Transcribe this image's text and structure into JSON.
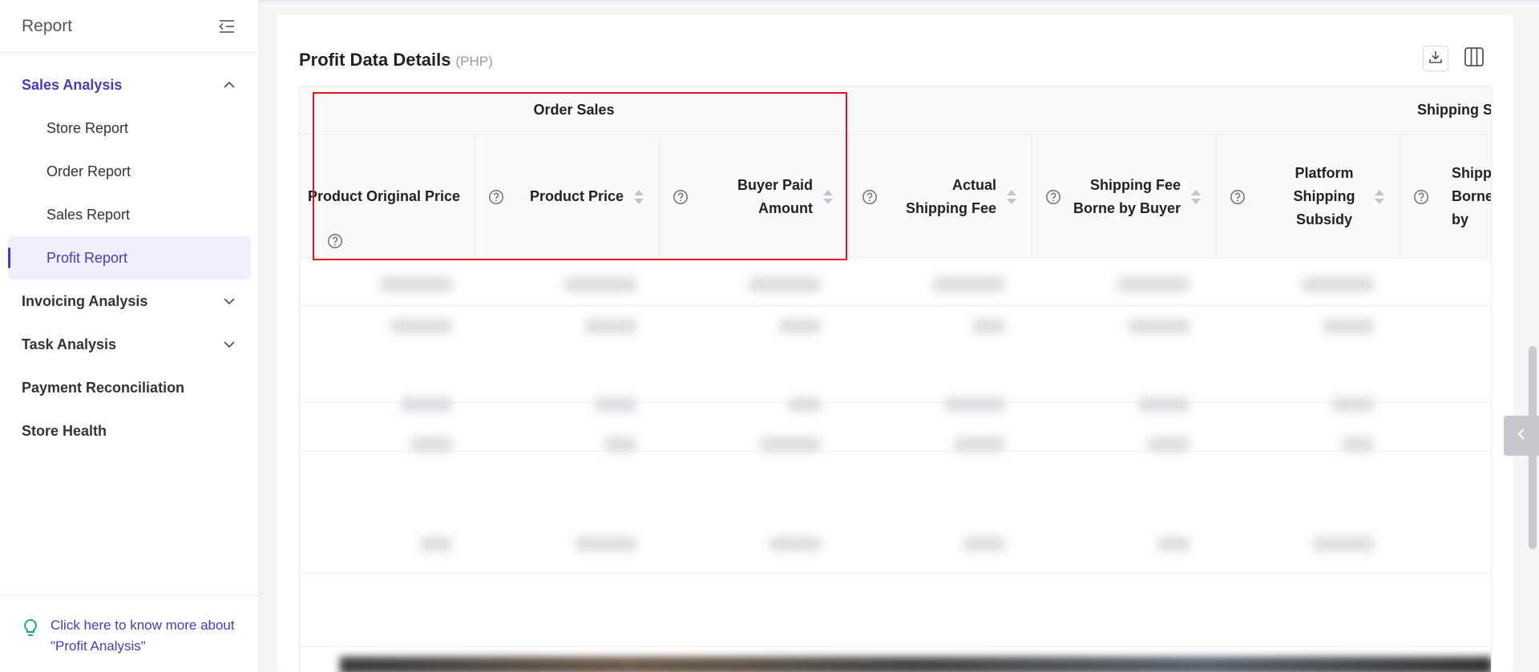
{
  "sidebar": {
    "title": "Report",
    "groups": [
      {
        "label": "Sales Analysis",
        "items": [
          "Store Report",
          "Order Report",
          "Sales Report",
          "Profit Report"
        ]
      },
      {
        "label": "Invoicing Analysis"
      },
      {
        "label": "Task Analysis"
      },
      {
        "label": "Payment Reconciliation"
      },
      {
        "label": "Store Health"
      }
    ],
    "footer_link": "Click here to know more about \"Profit Analysis\""
  },
  "main": {
    "title": "Profit Data Details",
    "currency": "(PHP)",
    "groups": {
      "order_sales": "Order Sales",
      "shipping": "Shipping S"
    },
    "columns": [
      "Product Original Price",
      "Product Price",
      "Buyer Paid Amount",
      "Actual Shipping Fee",
      "Shipping Fee Borne by Buyer",
      "Platform Shipping Subsidy",
      "Shippi Borne by"
    ]
  },
  "colors": {
    "accent": "#4a3bb8",
    "highlight": "#e0141e"
  }
}
